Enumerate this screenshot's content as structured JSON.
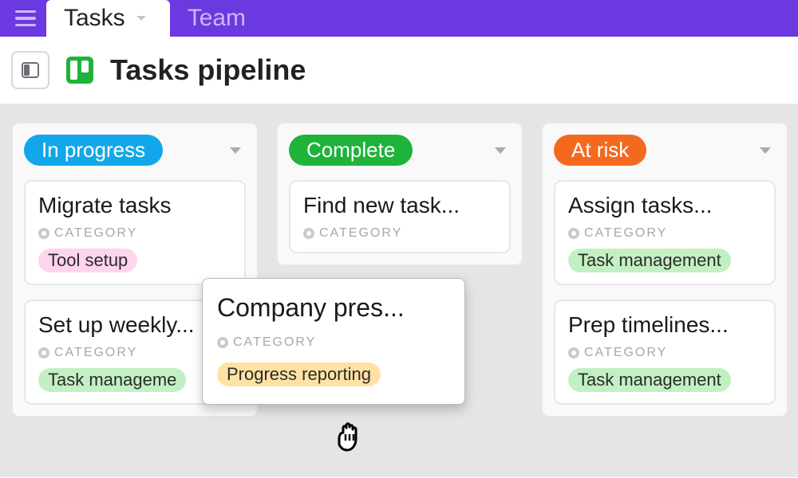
{
  "topbar": {
    "tabs": [
      {
        "label": "Tasks",
        "active": true
      },
      {
        "label": "Team",
        "active": false
      }
    ]
  },
  "page": {
    "title": "Tasks pipeline"
  },
  "category_label": "CATEGORY",
  "colors": {
    "in_progress": "#12a7ea",
    "complete": "#1fb33c",
    "at_risk": "#f36a1f",
    "tag_pink": "#ffd4ef",
    "tag_green": "#c3f0c3",
    "tag_yellow": "#ffe2a3"
  },
  "columns": [
    {
      "status": "In progress",
      "status_color_key": "in_progress",
      "cards": [
        {
          "title": "Migrate tasks",
          "tag": "Tool setup",
          "tag_color_key": "tag_pink"
        },
        {
          "title": "Set up weekly...",
          "tag": "Task manageme",
          "tag_color_key": "tag_green"
        }
      ]
    },
    {
      "status": "Complete",
      "status_color_key": "complete",
      "cards": [
        {
          "title": "Find new task...",
          "tag": "",
          "tag_color_key": ""
        }
      ]
    },
    {
      "status": "At risk",
      "status_color_key": "at_risk",
      "cards": [
        {
          "title": "Assign tasks...",
          "tag": "Task management",
          "tag_color_key": "tag_green"
        },
        {
          "title": "Prep timelines...",
          "tag": "Task management",
          "tag_color_key": "tag_green"
        }
      ]
    }
  ],
  "dragged_card": {
    "title": "Company pres...",
    "tag": "Progress reporting",
    "tag_color_key": "tag_yellow"
  }
}
